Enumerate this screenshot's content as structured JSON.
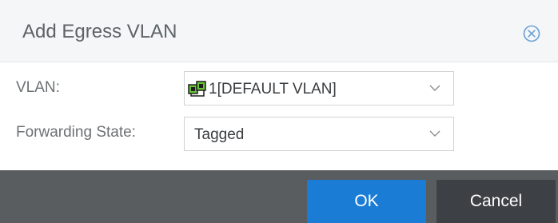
{
  "dialog": {
    "title": "Add Egress VLAN",
    "close_icon": "close-circle-icon"
  },
  "form": {
    "vlan_label": "VLAN:",
    "vlan_value": "1[DEFAULT VLAN]",
    "vlan_icon": "vlan-network-icon",
    "forwarding_label": "Forwarding State:",
    "forwarding_value": "Tagged"
  },
  "buttons": {
    "ok": "OK",
    "cancel": "Cancel"
  },
  "colors": {
    "accent": "#1b7cd6",
    "footer": "#5a5d60",
    "cancel_bg": "#3d4145"
  }
}
